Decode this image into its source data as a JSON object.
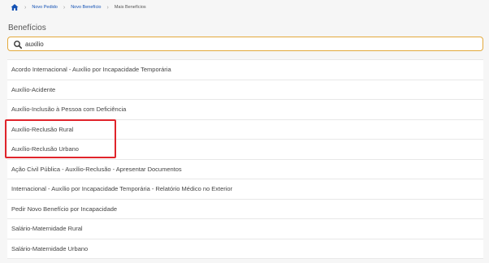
{
  "breadcrumb": {
    "home_icon": "home-icon",
    "items": [
      {
        "label": "Novo Pedido"
      },
      {
        "label": "Novo Benefício"
      },
      {
        "label": "Mais Benefícios"
      }
    ]
  },
  "page": {
    "title": "Benefícios"
  },
  "search": {
    "value": "auxilio",
    "icon": "search-icon",
    "border_color": "#e3a93c"
  },
  "results": [
    {
      "label": "Acordo Internacional - Auxílio por Incapacidade Temporária"
    },
    {
      "label": "Auxílio-Acidente"
    },
    {
      "label": "Auxílio-Inclusão à Pessoa com Deficiência"
    },
    {
      "label": "Auxílio-Reclusão Rural"
    },
    {
      "label": "Auxílio-Reclusão Urbano"
    },
    {
      "label": "Ação Civil Pública - Auxílio-Reclusão - Apresentar Documentos"
    },
    {
      "label": "Internacional - Auxílio por Incapacidade Temporária - Relatório Médico no Exterior"
    },
    {
      "label": "Pedir Novo Benefício por Incapacidade"
    },
    {
      "label": "Salário-Maternidade Rural"
    },
    {
      "label": "Salário-Maternidade Urbano"
    }
  ],
  "colors": {
    "link": "#1351b4",
    "highlight": "#e0242b"
  }
}
